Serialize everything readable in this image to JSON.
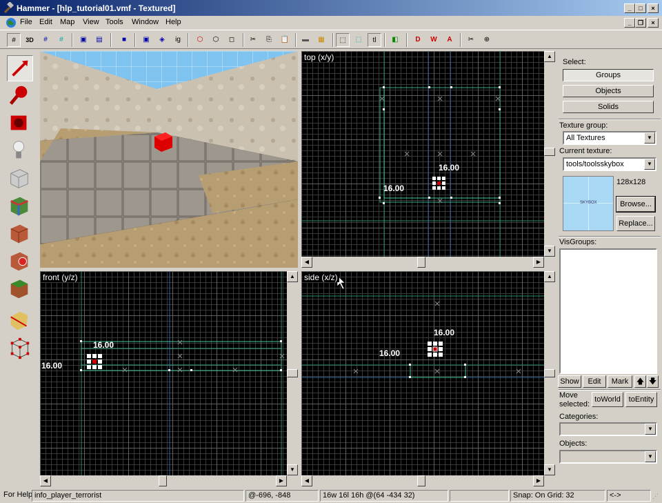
{
  "window": {
    "title": "Hammer - [hlp_tutorial01.vmf - Textured]"
  },
  "menu": [
    "File",
    "Edit",
    "Map",
    "View",
    "Tools",
    "Window",
    "Help"
  ],
  "toolbar": {
    "btn_3d": "3D",
    "btn_ig": "ig",
    "btn_tl": "tl"
  },
  "views": {
    "top": {
      "label": "top (x/y)",
      "dim_w": "16.00",
      "dim_h": "16.00"
    },
    "front": {
      "label": "front (y/z)",
      "dim_w": "16.00",
      "dim_h": "16.00"
    },
    "side": {
      "label": "side (x/z)",
      "dim_w": "16.00",
      "dim_h": "16.00"
    }
  },
  "panel": {
    "select_label": "Select:",
    "groups": "Groups",
    "objects": "Objects",
    "solids": "Solids",
    "texture_group_label": "Texture group:",
    "texture_group_value": "All Textures",
    "current_texture_label": "Current texture:",
    "current_texture_value": "tools/toolsskybox",
    "texture_size": "128x128",
    "texture_preview_text": "SKYBOX",
    "browse": "Browse...",
    "replace": "Replace...",
    "visgroups_label": "VisGroups:",
    "show": "Show",
    "edit": "Edit",
    "mark": "Mark",
    "move_selected_1": "Move",
    "move_selected_2": "selected:",
    "to_world": "toWorld",
    "to_entity": "toEntity",
    "categories_label": "Categories:",
    "objects_label": "Objects:"
  },
  "status": {
    "help": "For Help",
    "entity": "info_player_terrorist",
    "coords": "@-696, -848",
    "size": "16w 16l 16h @(64 -434 32)",
    "snap": "Snap: On Grid: 32",
    "arrows": "<->"
  }
}
